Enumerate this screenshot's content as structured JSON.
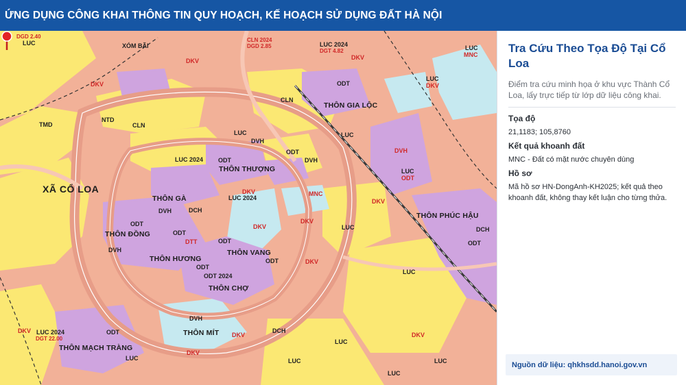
{
  "header": {
    "title": "ỨNG DỤNG CÔNG KHAI THÔNG TIN QUY HOẠCH, KẾ HOẠCH SỬ DỤNG ĐẤT HÀ NỘI"
  },
  "map": {
    "selected_marker": "location-pin-icon",
    "colors": {
      "residential": "#cfa4df",
      "agricultural": "#fbe873",
      "water": "#c6e9f0",
      "traffic": "#f4b59e",
      "marker": "#e32424"
    },
    "labels": {
      "luc_topleft": "LUC",
      "dgd_topleft": "DGD 2.40",
      "xom_bai": "XÓM BÃI",
      "cln_top": "CLN 2024",
      "dgd_top": "DGD 2.85",
      "luc2024_top": "LUC 2024",
      "dgd_top2": "DGT 4.82",
      "luc_mnc": "LUC",
      "mnc_topright": "MNC",
      "dkv_a": "DKV",
      "dkv_b": "DKV",
      "dkv_c": "DKV",
      "luc_dkv_right": "LUC",
      "dkv_right": "DKV",
      "odt_a": "ODT",
      "cln_a": "CLN",
      "thon_gia_loc": "THÔN GIA LỘC",
      "tmd": "TMD",
      "ntd": "NTD",
      "cln_b": "CLN",
      "luc_a": "LUC",
      "luc_b": "LUC",
      "dvh_a": "DVH",
      "odt_b": "ODT",
      "dvh_b": "DVH",
      "luc_2024_mid": "LUC 2024",
      "odt_c": "ODT",
      "thon_thuong": "THÔN THƯỢNG",
      "dvh_right": "DVH",
      "luc_right": "LUC",
      "odt_right": "ODT",
      "xa_co_loa": "XÃ CỔ LOA",
      "luc_center": "LUC 2024",
      "dkv_center": "DKV",
      "mnc_center": "MNC",
      "dkv_d": "DKV",
      "luc_c": "LUC",
      "dkv_e": "DKV",
      "thon_ga": "THÔN GÀ",
      "dvh_c": "DVH",
      "dch_a": "DCH",
      "odt_d": "ODT",
      "dkv_f": "DKV",
      "thon_phuc_hau": "THÔN PHÚC HẬU",
      "dch_right": "DCH",
      "odt_e": "ODT",
      "thon_dong": "THÔN ĐỒNG",
      "odt_f": "ODT",
      "dtt": "DTT",
      "odt_g": "ODT",
      "dvh_d": "DVH",
      "thon_huong": "THÔN HƯƠNG",
      "thon_vang": "THÔN VANG",
      "odt_h": "ODT",
      "dkv_g": "DKV",
      "odt_i": "ODT",
      "odt_2024": "ODT 2024",
      "thon_cho": "THÔN CHỢ",
      "luc_d": "LUC",
      "dvh_e": "DVH",
      "thon_mit": "THÔN MÍT",
      "dkv_h": "DKV",
      "dch_b": "DCH",
      "dkv_left": "DKV",
      "luc_2024_bl": "LUC 2024",
      "dgt_bl": "DGT 22.00",
      "odt_bl": "ODT",
      "thon_mach_trang": "THÔN MẠCH TRÀNG",
      "luc_e": "LUC",
      "dkv_i": "DKV",
      "luc_f": "LUC",
      "dkv_j": "DKV",
      "luc_g": "LUC",
      "luc_h": "LUC",
      "luc_bottom": "LUC"
    }
  },
  "panel": {
    "title": "Tra Cứu Theo Tọa Độ Tại Cổ Loa",
    "description": "Điểm tra cứu minh họa ở khu vực Thành Cổ Loa, lấy trực tiếp từ lớp dữ liệu công khai.",
    "fields": [
      {
        "label": "Tọa độ",
        "value": "21,1183; 105,8760"
      },
      {
        "label": "Kết quả khoanh đất",
        "value": "MNC - Đất có mặt nước chuyên dùng"
      },
      {
        "label": "Hồ sơ",
        "value": "Mã hồ sơ HN-DongAnh-KH2025; kết quả theo khoanh đất, không thay kết luận cho từng thửa."
      }
    ],
    "source": "Nguồn dữ liệu: qhkhsdd.hanoi.gov.vn"
  }
}
